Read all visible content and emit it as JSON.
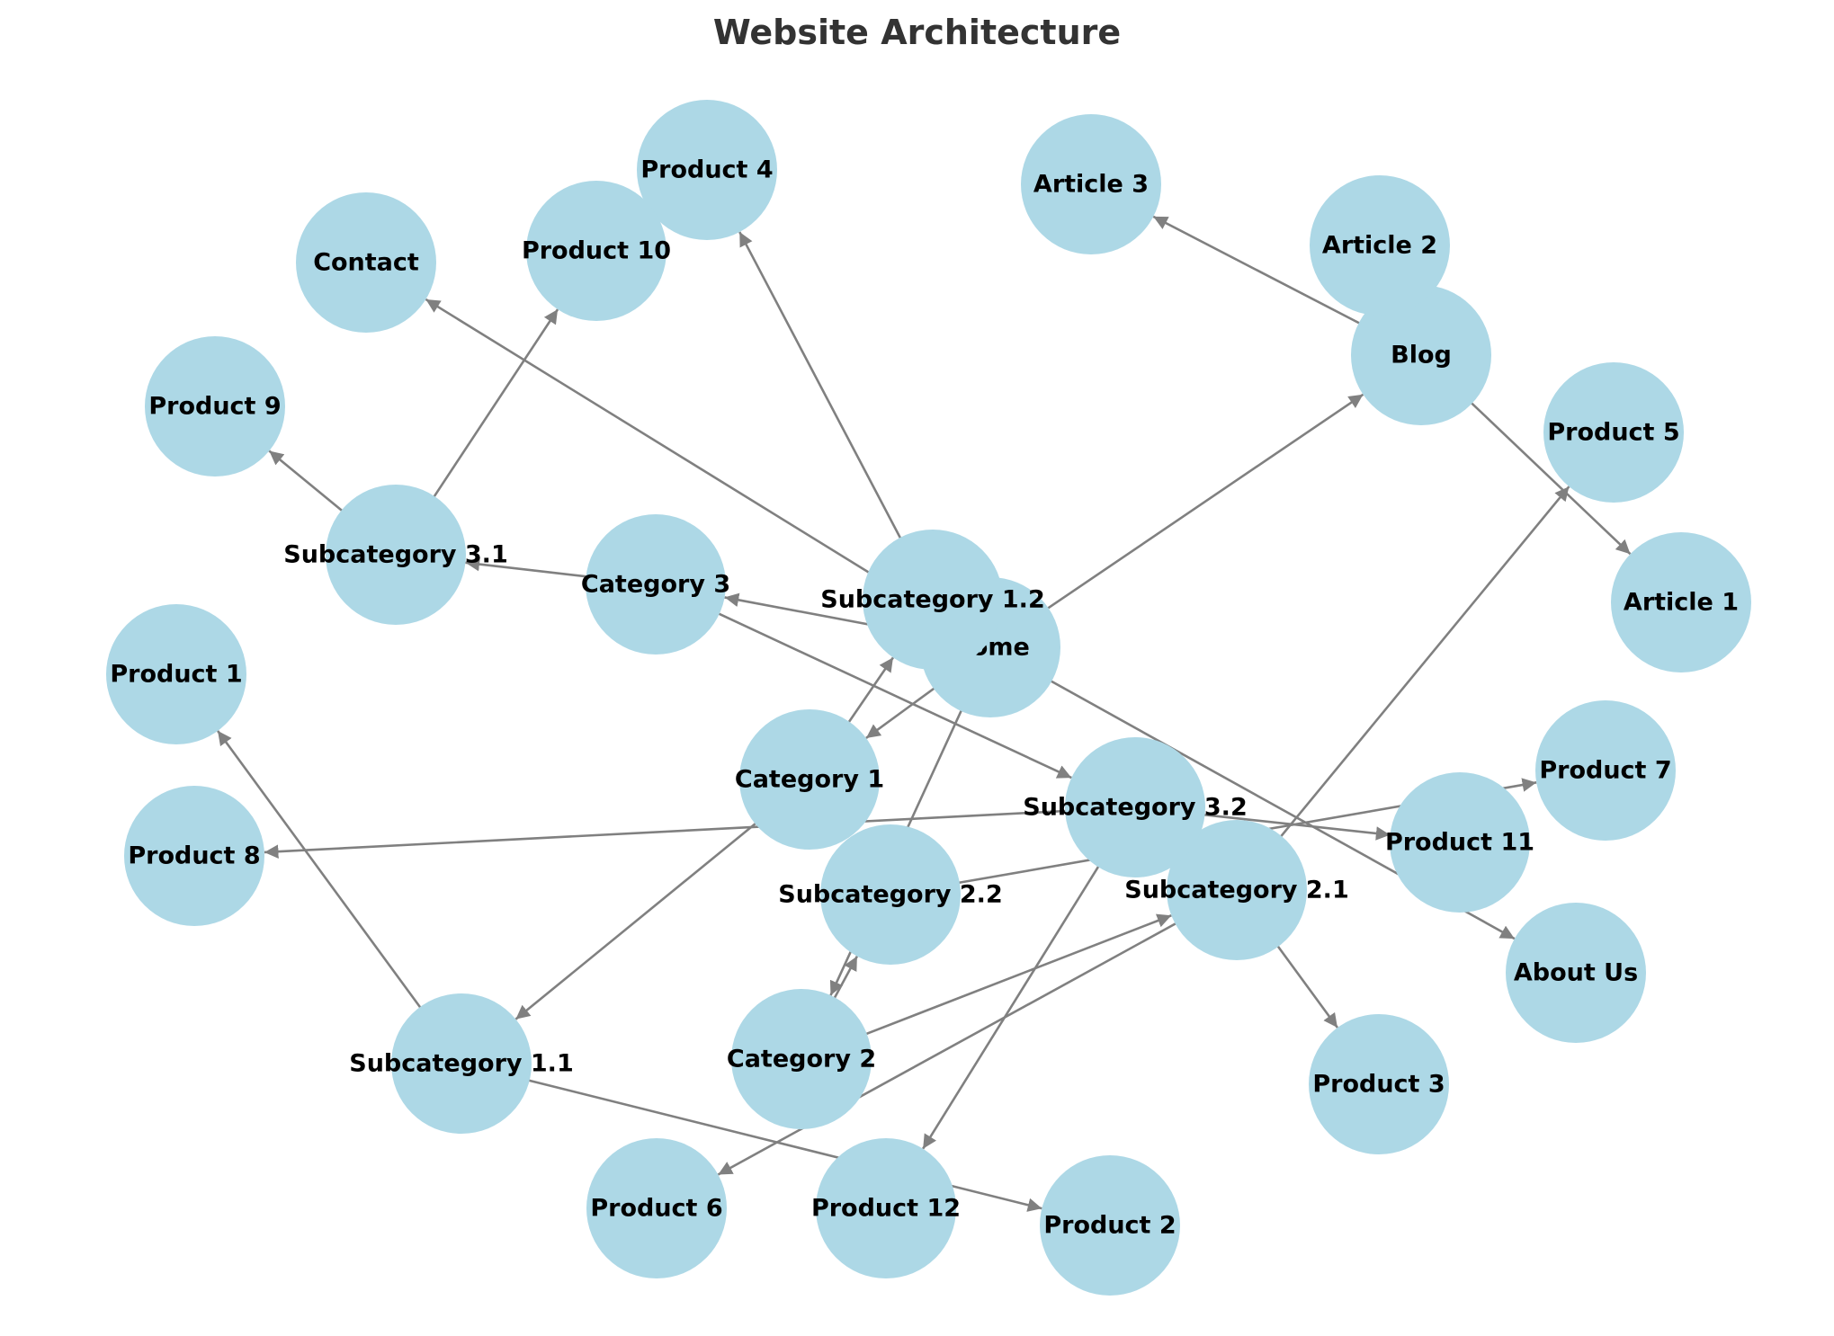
{
  "title": "Website Architecture",
  "colors": {
    "node_fill": "#add8e6",
    "edge": "#808080",
    "label": "#000000",
    "title": "#333333"
  },
  "chart_data": {
    "type": "network",
    "title": "Website Architecture",
    "directed": true,
    "nodes": [
      {
        "id": "Home"
      },
      {
        "id": "Category 1"
      },
      {
        "id": "Category 2"
      },
      {
        "id": "Category 3"
      },
      {
        "id": "Subcategory 1.1"
      },
      {
        "id": "Subcategory 1.2"
      },
      {
        "id": "Subcategory 2.1"
      },
      {
        "id": "Subcategory 2.2"
      },
      {
        "id": "Subcategory 3.1"
      },
      {
        "id": "Subcategory 3.2"
      },
      {
        "id": "Product 1"
      },
      {
        "id": "Product 2"
      },
      {
        "id": "Product 3"
      },
      {
        "id": "Product 4"
      },
      {
        "id": "Product 5"
      },
      {
        "id": "Product 6"
      },
      {
        "id": "Product 7"
      },
      {
        "id": "Product 8"
      },
      {
        "id": "Product 9"
      },
      {
        "id": "Product 10"
      },
      {
        "id": "Product 11"
      },
      {
        "id": "Product 12"
      },
      {
        "id": "Blog"
      },
      {
        "id": "Article 1"
      },
      {
        "id": "Article 2"
      },
      {
        "id": "Article 3"
      },
      {
        "id": "About Us"
      },
      {
        "id": "Contact"
      }
    ],
    "edges": [
      [
        "Home",
        "Category 1"
      ],
      [
        "Home",
        "Category 2"
      ],
      [
        "Home",
        "Category 3"
      ],
      [
        "Home",
        "Blog"
      ],
      [
        "Home",
        "About Us"
      ],
      [
        "Home",
        "Contact"
      ],
      [
        "Category 1",
        "Subcategory 1.1"
      ],
      [
        "Category 1",
        "Subcategory 1.2"
      ],
      [
        "Category 2",
        "Subcategory 2.1"
      ],
      [
        "Category 2",
        "Subcategory 2.2"
      ],
      [
        "Category 3",
        "Subcategory 3.1"
      ],
      [
        "Category 3",
        "Subcategory 3.2"
      ],
      [
        "Subcategory 1.1",
        "Product 1"
      ],
      [
        "Subcategory 1.1",
        "Product 2"
      ],
      [
        "Subcategory 1.2",
        "Product 4"
      ],
      [
        "Subcategory 2.1",
        "Product 3"
      ],
      [
        "Subcategory 2.1",
        "Product 5"
      ],
      [
        "Subcategory 2.1",
        "Product 6"
      ],
      [
        "Subcategory 2.2",
        "Product 7"
      ],
      [
        "Subcategory 3.1",
        "Product 9"
      ],
      [
        "Subcategory 3.1",
        "Product 10"
      ],
      [
        "Subcategory 3.2",
        "Product 8"
      ],
      [
        "Subcategory 3.2",
        "Product 11"
      ],
      [
        "Subcategory 3.2",
        "Product 12"
      ],
      [
        "Blog",
        "Article 1"
      ],
      [
        "Blog",
        "Article 2"
      ],
      [
        "Blog",
        "Article 3"
      ]
    ]
  }
}
